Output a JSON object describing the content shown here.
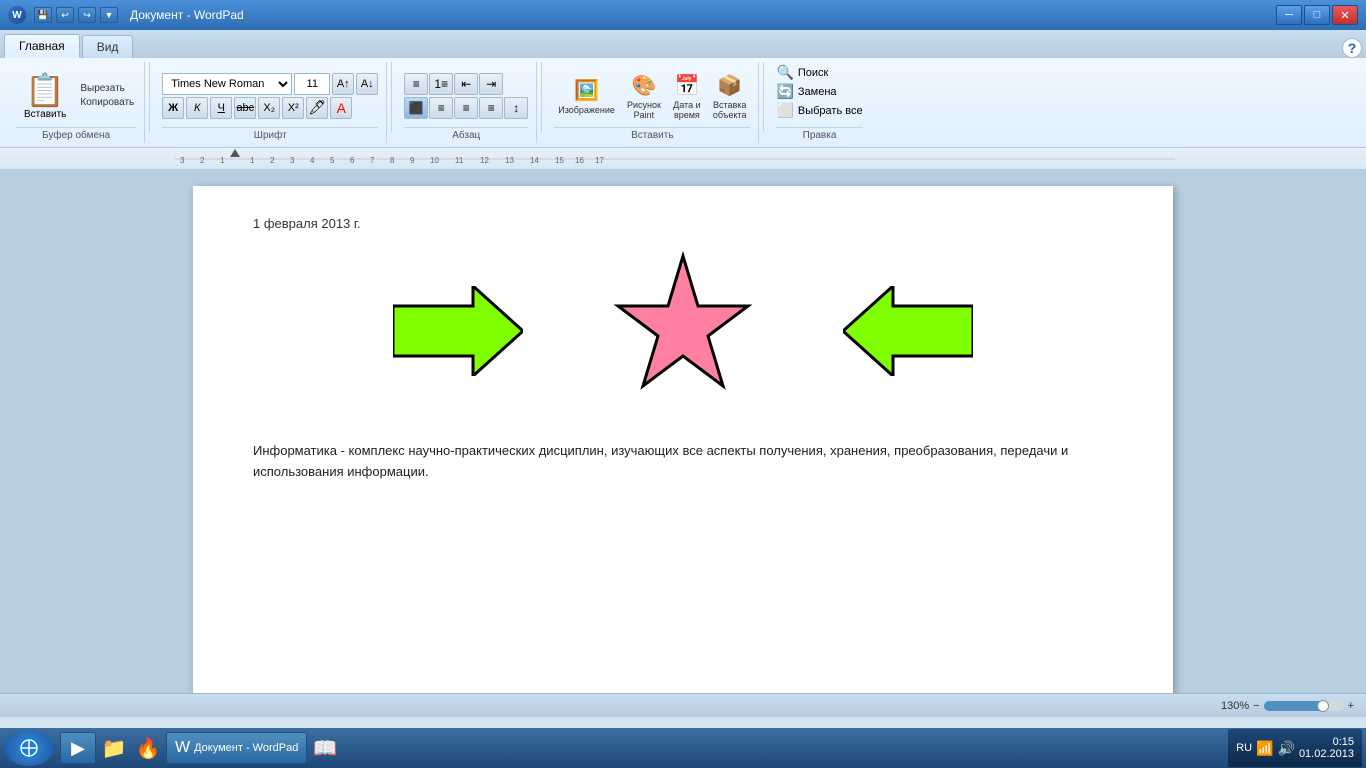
{
  "titleBar": {
    "title": "Документ - WordPad",
    "minBtn": "─",
    "maxBtn": "□",
    "closeBtn": "✕",
    "helpBtn": "?"
  },
  "ribbon": {
    "tabs": [
      {
        "id": "home",
        "label": "Главная",
        "active": true
      },
      {
        "id": "view",
        "label": "Вид",
        "active": false
      }
    ],
    "groups": {
      "clipboard": {
        "label": "Буфер обмена",
        "paste": "Вставить",
        "cut": "Вырезать",
        "copy": "Копировать"
      },
      "font": {
        "label": "Шрифт",
        "fontName": "Times New Roman",
        "fontSize": "11",
        "boldLabel": "Ж",
        "italicLabel": "К",
        "underlineLabel": "Ч",
        "strikeLabel": "abc",
        "subLabel": "Х₂",
        "supLabel": "Х²"
      },
      "paragraph": {
        "label": "Абзац"
      },
      "insert": {
        "label": "Вставить",
        "image": "Изображение",
        "paint": "Рисунок\nPaint",
        "datetime": "Дата и\nвремя",
        "object": "Вставка\nобъекта"
      },
      "search": {
        "label": "Правка",
        "find": "Поиск",
        "replace": "Замена",
        "selectAll": "Выбрать все"
      }
    }
  },
  "document": {
    "date": "1 февраля 2013 г.",
    "bodyText": "Информатика - комплекс научно-практических дисциплин, изучающих все аспекты получения, хранения, преобразования, передачи и использования информации."
  },
  "statusBar": {
    "zoom": "130%"
  },
  "taskbar": {
    "time": "0:15",
    "date": "01.02.2013",
    "lang": "RU"
  }
}
